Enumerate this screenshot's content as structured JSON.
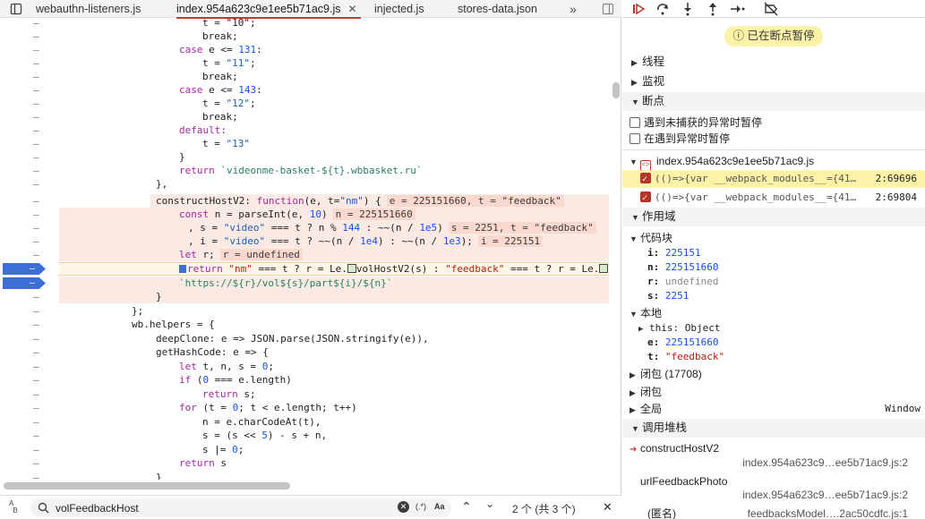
{
  "tabs": [
    {
      "label": "webauthn-listeners.js",
      "active": false
    },
    {
      "label": "index.954a623c9e1ee5b71ac9.js",
      "active": true
    },
    {
      "label": "injected.js",
      "active": false
    },
    {
      "label": "stores-data.json",
      "active": false
    }
  ],
  "tabs_more": "»",
  "search": {
    "value": "volFeedbackHost",
    "regex_label": "(.*)",
    "case_label": "Aa",
    "match_count": "2 个 (共 3 个)"
  },
  "debugger": {
    "paused_label": "已在断点暂停",
    "sections": {
      "threads": "线程",
      "watch": "监视",
      "breakpoints": "断点",
      "scope": "作用域",
      "callstack": "调用堆栈"
    },
    "pause_uncaught": "遇到未捕获的异常时暂停",
    "pause_caught": "在遇到异常时暂停",
    "bp_file": "index.954a623c9e1ee5b71ac9.js",
    "bp_items": [
      {
        "code": "(()=>{var __webpack_modules__={41…",
        "loc": "2:69696"
      },
      {
        "code": "(()=>{var __webpack_modules__={41…",
        "loc": "2:69804"
      }
    ],
    "block_label": "代码块",
    "block_vars": [
      {
        "k": "i:",
        "v": "225151"
      },
      {
        "k": "n:",
        "v": "225151660"
      },
      {
        "k": "r:",
        "v": "undefined"
      },
      {
        "k": "s:",
        "v": "2251"
      }
    ],
    "local_label": "本地",
    "local_this": "this: Object",
    "local_vars": [
      {
        "k": "e:",
        "v": "225151660"
      },
      {
        "k": "t:",
        "v": "\"feedback\""
      }
    ],
    "closure_a": "闭包 (17708)",
    "closure_b": "闭包",
    "global_label": "全局",
    "global_value": "Window",
    "frames": [
      {
        "name": "constructHostV2",
        "loc": "index.954a623c9…ee5b71ac9.js:2"
      },
      {
        "name": "urlFeedbackPhoto",
        "loc": "index.954a623c9…ee5b71ac9.js:2"
      },
      {
        "name": "(匿名)",
        "loc": "feedbacksModel….2ac50cdfc.js:1"
      }
    ]
  },
  "code": {
    "l01": "t = \"10\";",
    "l02": "break;",
    "l03a": "case",
    "l03b": "e <= ",
    "l03c": "131",
    "l03d": ":",
    "l04a": "t = ",
    "l04b": "\"11\"",
    "l04c": ";",
    "l05": "break;",
    "l06a": "case",
    "l06b": "e <= ",
    "l06c": "143",
    "l06d": ":",
    "l07a": "t = ",
    "l07b": "\"12\"",
    "l07c": ";",
    "l08": "break;",
    "l09": "default:",
    "l10a": "t = ",
    "l10b": "\"13\"",
    "l11": "}",
    "l12a": "return ",
    "l12b": "`videonme-basket-${t}.wbbasket.ru`",
    "l13": "},",
    "l14a": "constructHostV2: ",
    "l14b": "function",
    "l14c": "(e, t=",
    "l14d": "\"nm\"",
    "l14e": ") {",
    "l14i": "e = 225151660, t = \"feedback\"",
    "l15a": "const",
    "l15b": " n = parseInt(e, ",
    "l15c": "10",
    "l15d": ")",
    "l15i": "n = 225151660",
    "l16a": ", s = ",
    "l16b": "\"video\"",
    "l16c": " === t ? n % ",
    "l16d": "144",
    "l16e": " : ~~(n / ",
    "l16f": "1e5",
    "l16g": ")",
    "l16i": "s = 2251, t = \"feedback\"",
    "l17a": ", i = ",
    "l17b": "\"video\"",
    "l17c": " === t ? ~~(n / ",
    "l17d": "1e4",
    "l17e": ") : ~~(n / ",
    "l17f": "1e3",
    "l17g": ");",
    "l17i": "i = 225151",
    "l18a": "let",
    "l18b": " r;",
    "l18i": "r = undefined",
    "l19a": "return",
    "l19b": " ",
    "l19c": "\"nm\"",
    "l19d": " === t ? r = Le.",
    "l19e": "volHostV2(s) : ",
    "l19f": "\"feedback\"",
    "l19g": " === t ? r = Le.",
    "l20": "`https://${r}/vol${s}/part${i}/${n}`",
    "l21": "}",
    "l22": "};",
    "l23": "wb.helpers = {",
    "l24": "deepClone: e => JSON.parse(JSON.stringify(e)),",
    "l25": "getHashCode: e => {",
    "l26a": "let",
    "l26b": " t, n, s = ",
    "l26c": "0",
    "l26d": ";",
    "l27a": "if",
    "l27b": " (",
    "l27c": "0",
    "l27d": " === e.length)",
    "l28a": "return",
    "l28b": " s;",
    "l29a": "for",
    "l29b": " (t = ",
    "l29c": "0",
    "l29d": "; t < e.length; t++)",
    "l30": "n = e.charCodeAt(t),",
    "l31a": "s = (s << ",
    "l31b": "5",
    "l31c": ") - s + n,",
    "l32a": "s |= ",
    "l32b": "0",
    "l32c": ";",
    "l33a": "return",
    "l33b": " s",
    "l34": "}",
    "gutter": "–"
  },
  "colors": {
    "accent": "#c4392f",
    "breakpoint": "#3b6fd6",
    "paused": "#fdf3a8",
    "value_hl": "#fbd8cd"
  }
}
